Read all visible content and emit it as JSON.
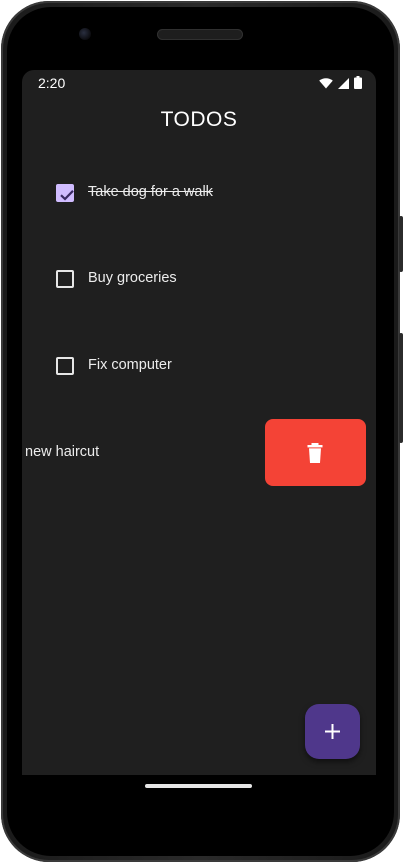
{
  "status_bar": {
    "time": "2:20",
    "icons": [
      "wifi-icon",
      "cellular-signal-icon",
      "battery-icon"
    ]
  },
  "app": {
    "title": "TODOS"
  },
  "todos": [
    {
      "label": "Take dog for a walk",
      "checked": true
    },
    {
      "label": "Buy groceries",
      "checked": false
    },
    {
      "label": "Fix computer",
      "checked": false
    }
  ],
  "swiping_item": {
    "label": "new haircut",
    "action_icon": "trash-icon",
    "action_color": "#f44336"
  },
  "fab": {
    "icon": "plus-icon",
    "color": "#4f378b"
  },
  "colors": {
    "background": "#1f1f1f",
    "accent_checkbox": "#d0bcff",
    "delete": "#f44336"
  }
}
